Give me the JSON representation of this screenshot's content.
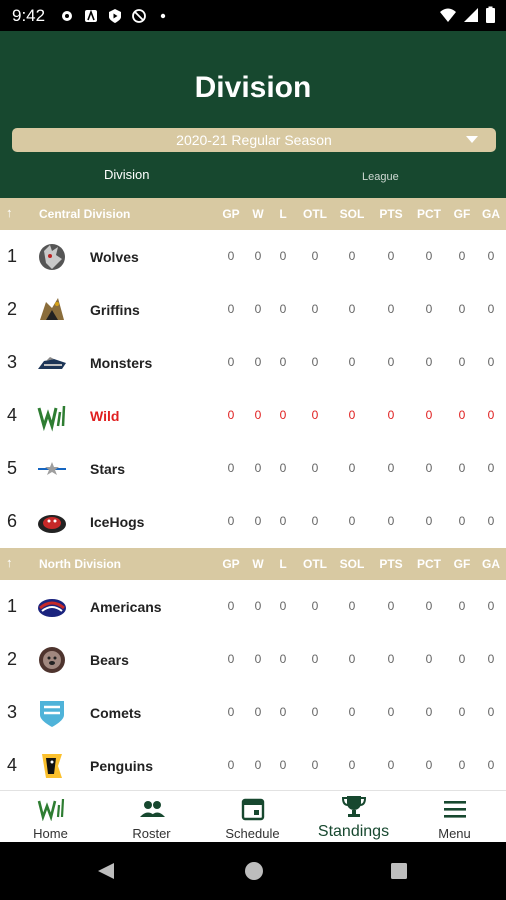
{
  "status_bar": {
    "time": "9:42"
  },
  "header": {
    "title": "Division",
    "season": "2020-21 Regular Season",
    "tabs": {
      "division": "Division",
      "league": "League"
    }
  },
  "columns": [
    "GP",
    "W",
    "L",
    "OTL",
    "SOL",
    "PTS",
    "PCT",
    "GF",
    "GA"
  ],
  "divisions": [
    {
      "name": "Central Division",
      "teams": [
        {
          "rank": "1",
          "name": "Wolves",
          "stats": [
            "0",
            "0",
            "0",
            "0",
            "0",
            "0",
            "0",
            "0",
            "0"
          ]
        },
        {
          "rank": "2",
          "name": "Griffins",
          "stats": [
            "0",
            "0",
            "0",
            "0",
            "0",
            "0",
            "0",
            "0",
            "0"
          ]
        },
        {
          "rank": "3",
          "name": "Monsters",
          "stats": [
            "0",
            "0",
            "0",
            "0",
            "0",
            "0",
            "0",
            "0",
            "0"
          ]
        },
        {
          "rank": "4",
          "name": "Wild",
          "stats": [
            "0",
            "0",
            "0",
            "0",
            "0",
            "0",
            "0",
            "0",
            "0"
          ]
        },
        {
          "rank": "5",
          "name": "Stars",
          "stats": [
            "0",
            "0",
            "0",
            "0",
            "0",
            "0",
            "0",
            "0",
            "0"
          ]
        },
        {
          "rank": "6",
          "name": "IceHogs",
          "stats": [
            "0",
            "0",
            "0",
            "0",
            "0",
            "0",
            "0",
            "0",
            "0"
          ]
        }
      ]
    },
    {
      "name": "North Division",
      "teams": [
        {
          "rank": "1",
          "name": "Americans",
          "stats": [
            "0",
            "0",
            "0",
            "0",
            "0",
            "0",
            "0",
            "0",
            "0"
          ]
        },
        {
          "rank": "2",
          "name": "Bears",
          "stats": [
            "0",
            "0",
            "0",
            "0",
            "0",
            "0",
            "0",
            "0",
            "0"
          ]
        },
        {
          "rank": "3",
          "name": "Comets",
          "stats": [
            "0",
            "0",
            "0",
            "0",
            "0",
            "0",
            "0",
            "0",
            "0"
          ]
        },
        {
          "rank": "4",
          "name": "Penguins",
          "stats": [
            "0",
            "0",
            "0",
            "0",
            "0",
            "0",
            "0",
            "0",
            "0"
          ]
        }
      ]
    }
  ],
  "nav": {
    "home": "Home",
    "roster": "Roster",
    "schedule": "Schedule",
    "standings": "Standings",
    "menu": "Menu"
  },
  "colors": {
    "header_green": "#17482f",
    "gold": "#d8c9a2",
    "highlight_red": "#e02020"
  }
}
